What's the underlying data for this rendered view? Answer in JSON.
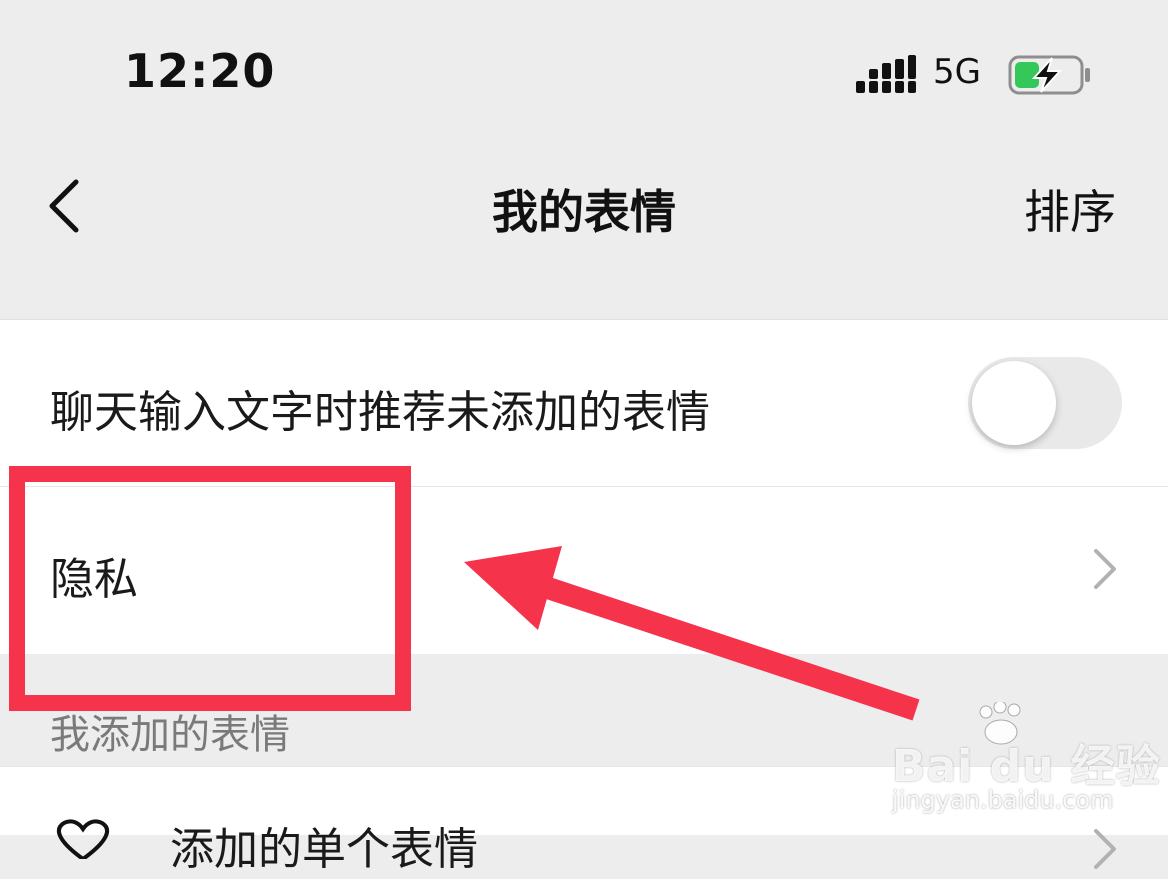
{
  "status_bar": {
    "time": "12:20",
    "network": "5G",
    "battery_color": "#34c759"
  },
  "nav": {
    "title": "我的表情",
    "right_action": "排序",
    "back_icon": "chevron-left-icon"
  },
  "settings": {
    "recommend_toggle_label": "聊天输入文字时推荐未添加的表情",
    "recommend_toggle_on": false,
    "privacy_label": "隐私"
  },
  "section": {
    "header": "我添加的表情",
    "partial_item_label": "添加的单个表情"
  },
  "annotation": {
    "highlight_color": "#f5334b"
  },
  "watermark": {
    "brand": "Bai du 经验",
    "url": "jingyan.baidu.com"
  }
}
